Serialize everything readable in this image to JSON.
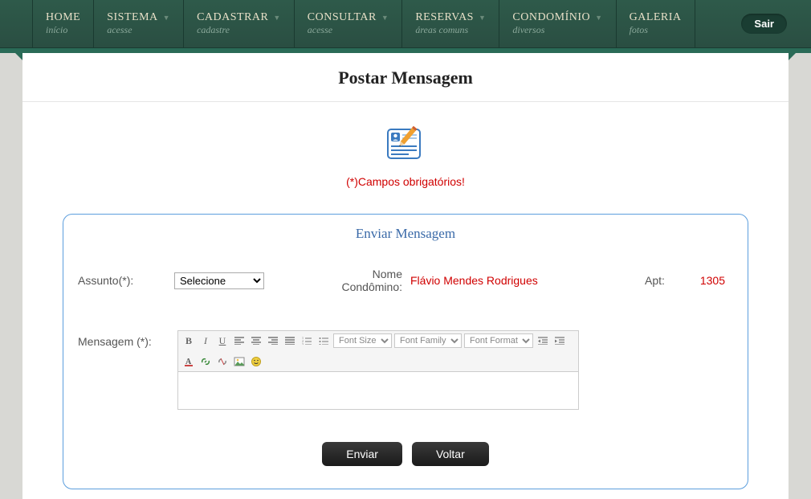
{
  "nav": {
    "items": [
      {
        "title": "HOME",
        "sub": "início",
        "dropdown": false
      },
      {
        "title": "SISTEMA",
        "sub": "acesse",
        "dropdown": true
      },
      {
        "title": "CADASTRAR",
        "sub": "cadastre",
        "dropdown": true
      },
      {
        "title": "CONSULTAR",
        "sub": "acesse",
        "dropdown": true
      },
      {
        "title": "RESERVAS",
        "sub": "áreas comuns",
        "dropdown": true
      },
      {
        "title": "CONDOMÍNIO",
        "sub": "diversos",
        "dropdown": true
      },
      {
        "title": "GALERIA",
        "sub": "fotos",
        "dropdown": false
      }
    ],
    "logout": "Sair"
  },
  "page": {
    "title": "Postar Mensagem",
    "required_note": "(*)Campos obrigatórios!"
  },
  "form": {
    "title": "Enviar Mensagem",
    "assunto_label": "Assunto(*):",
    "assunto_selected": "Selecione",
    "nome_label": "Nome Condômino:",
    "nome_value": "Flávio Mendes Rodrigues",
    "apt_label": "Apt:",
    "apt_value": "1305",
    "mensagem_label": "Mensagem (*):",
    "toolbar": {
      "font_size": "Font Size",
      "font_family": "Font Family",
      "font_format": "Font Format"
    },
    "buttons": {
      "send": "Enviar",
      "back": "Voltar"
    }
  }
}
